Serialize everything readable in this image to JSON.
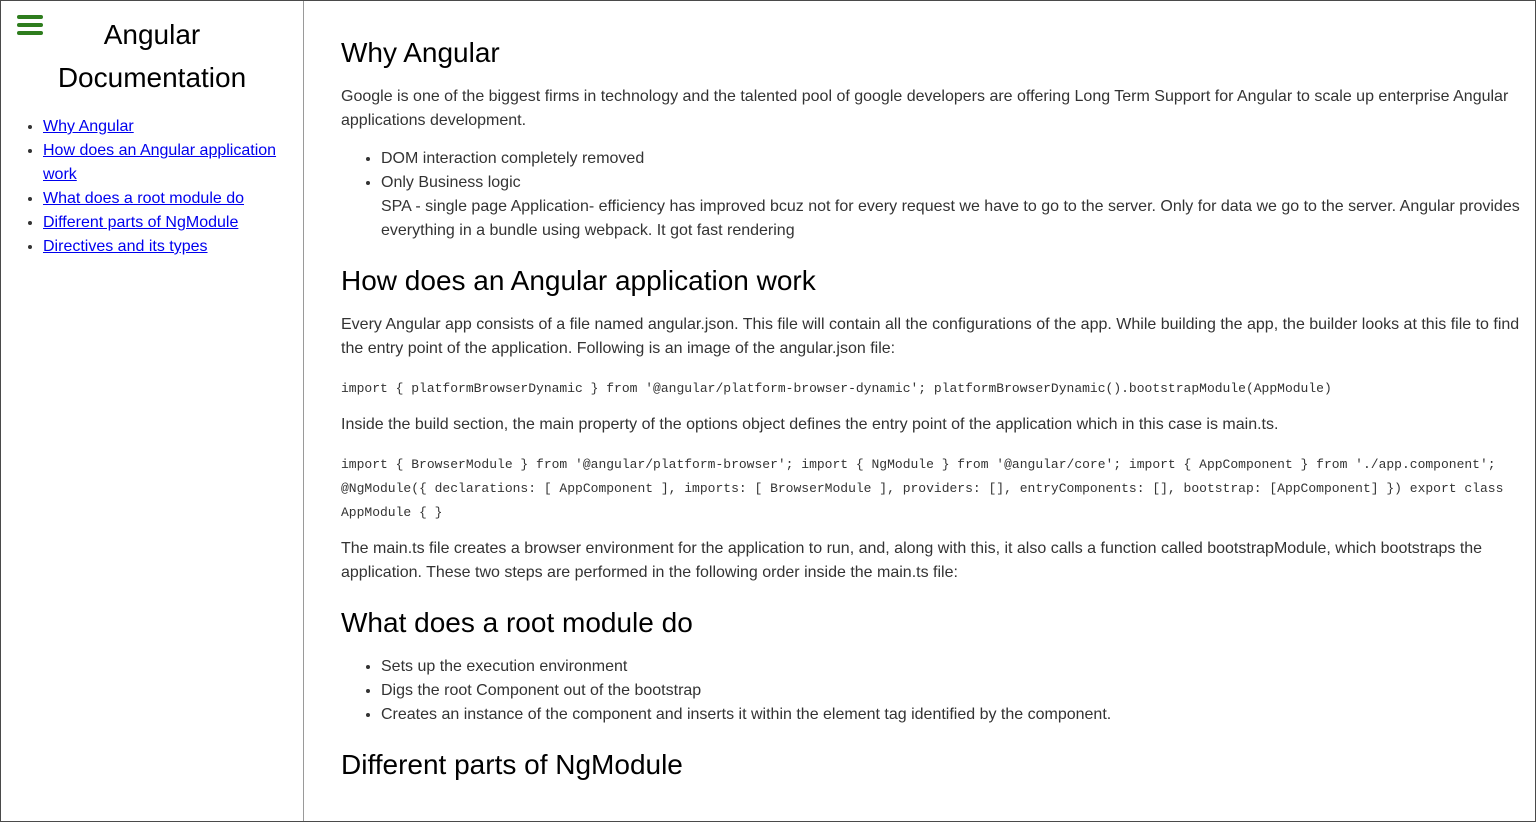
{
  "colors": {
    "hamburger": "#2e7d1e",
    "link": "#0000ee",
    "text": "#333333",
    "heading": "#000000"
  },
  "sidebar": {
    "menu_icon": "hamburger-menu-icon",
    "title_line1": "Angular",
    "title_line2": "Documentation",
    "nav": [
      {
        "label": "Why Angular"
      },
      {
        "label": "How does an Angular application work"
      },
      {
        "label": "What does a root module do"
      },
      {
        "label": "Different parts of NgModule"
      },
      {
        "label": "Directives and its types"
      }
    ]
  },
  "main": {
    "s1": {
      "heading": "Why Angular",
      "p1": "Google is one of the biggest firms in technology and the talented pool of google developers are offering Long Term Support for Angular to scale up enterprise Angular applications development.",
      "bullets": [
        "DOM interaction completely removed",
        "Only Business logic"
      ],
      "bullet_extra": "SPA - single page Application- efficiency has improved bcuz not for every request we have to go to the server. Only for data we go to the server. Angular provides everything in a bundle using webpack. It got fast rendering"
    },
    "s2": {
      "heading": "How does an Angular application work",
      "p1": "Every Angular app consists of a file named angular.json. This file will contain all the configurations of the app. While building the app, the builder looks at this file to find the entry point of the application. Following is an image of the angular.json file:",
      "code1": "import { platformBrowserDynamic } from '@angular/platform-browser-dynamic'; platformBrowserDynamic().bootstrapModule(AppModule)",
      "p2": "Inside the build section, the main property of the options object defines the entry point of the application which in this case is main.ts.",
      "code2": "import { BrowserModule } from '@angular/platform-browser'; import { NgModule } from '@angular/core'; import { AppComponent } from './app.component'; @NgModule({ declarations: [ AppComponent ], imports: [ BrowserModule ], providers: [], entryComponents: [], bootstrap: [AppComponent] }) export class AppModule { }",
      "p3": "The main.ts file creates a browser environment for the application to run, and, along with this, it also calls a function called bootstrapModule, which bootstraps the application. These two steps are performed in the following order inside the main.ts file:"
    },
    "s3": {
      "heading": "What does a root module do",
      "bullets": [
        "Sets up the execution environment",
        "Digs the root Component out of the bootstrap",
        "Creates an instance of the component and inserts it within the element tag identified by the component."
      ]
    },
    "s4": {
      "heading": "Different parts of NgModule"
    }
  }
}
